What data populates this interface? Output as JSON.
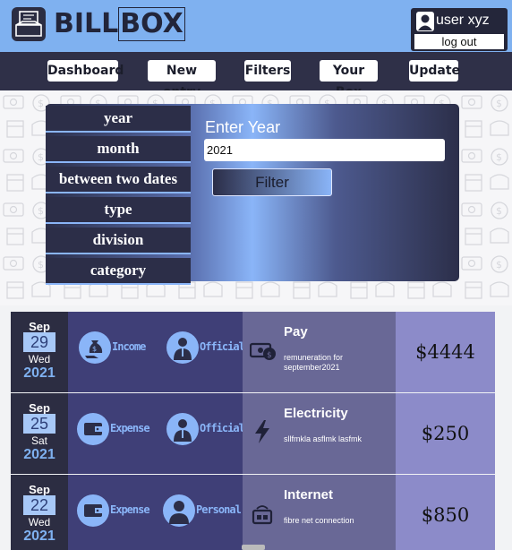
{
  "app": {
    "logo_text_a": "BILL",
    "logo_text_b": "BOX"
  },
  "user": {
    "name": "user xyz",
    "logout_label": "log out"
  },
  "nav": [
    "Dashboard",
    "New entry",
    "Filters",
    "Your Box",
    "Update"
  ],
  "filter": {
    "options": [
      "year",
      "month",
      "between two dates",
      "type",
      "division",
      "category"
    ],
    "prompt": "Enter Year",
    "year_value": "2021",
    "button_label": "Filter"
  },
  "entries": [
    {
      "month": "Sep",
      "day": "29",
      "weekday": "Wed",
      "year": "2021",
      "type": "Income",
      "division": "Official",
      "category_icon": "cash-icon",
      "title": "Pay",
      "description": "remuneration for september2021",
      "amount": "$4444"
    },
    {
      "month": "Sep",
      "day": "25",
      "weekday": "Sat",
      "year": "2021",
      "type": "Expense",
      "division": "Official",
      "category_icon": "lightning-icon",
      "title": "Electricity",
      "description": "sllfmkla asflmk lasfmk",
      "amount": "$250"
    },
    {
      "month": "Sep",
      "day": "22",
      "weekday": "Wed",
      "year": "2021",
      "type": "Expense",
      "division": "Personal",
      "category_icon": "router-icon",
      "title": "Internet",
      "description": "fibre net connection",
      "amount": "$850"
    }
  ],
  "colors": {
    "topbar": "#7fb1f0",
    "navbar": "#2f3048",
    "accent": "#8ab5f8",
    "tag_bg": "#3f3f77",
    "info_bg": "#696896",
    "amount_bg": "#8c8bc9"
  }
}
